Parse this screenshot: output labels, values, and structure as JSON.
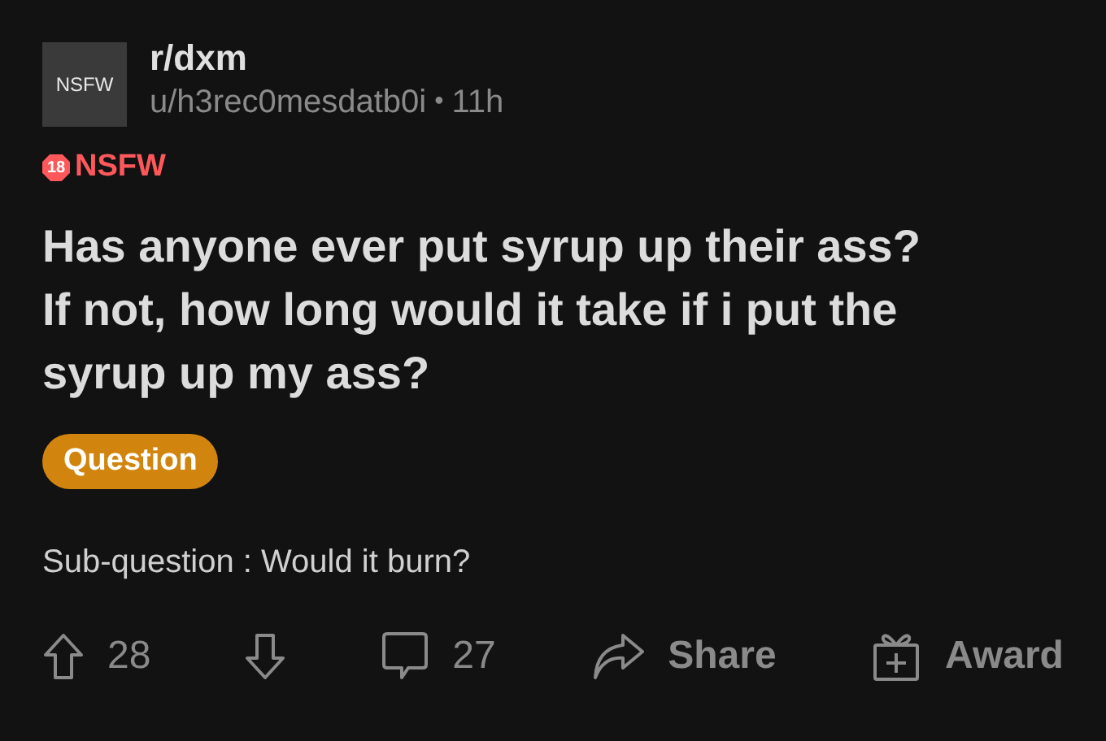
{
  "post": {
    "avatar_label": "NSFW",
    "subreddit": "r/dxm",
    "author": "u/h3rec0mesdatb0i",
    "separator": "•",
    "age": "11h",
    "nsfw": {
      "age_mark": "18",
      "label": "NSFW"
    },
    "title_lines": [
      "Has anyone ever put syrup up their ass?",
      "If not, how long would it take if i put the",
      "syrup up my ass?"
    ],
    "flair": {
      "label": "Question",
      "color": "#d2850e"
    },
    "body": "Sub-question : Would it burn?"
  },
  "actions": [
    {
      "kind": "upvote",
      "label": "28"
    },
    {
      "kind": "downvote"
    },
    {
      "kind": "comment",
      "label": "27"
    },
    {
      "kind": "share",
      "label": "Share"
    },
    {
      "kind": "award",
      "label": "Award"
    }
  ]
}
